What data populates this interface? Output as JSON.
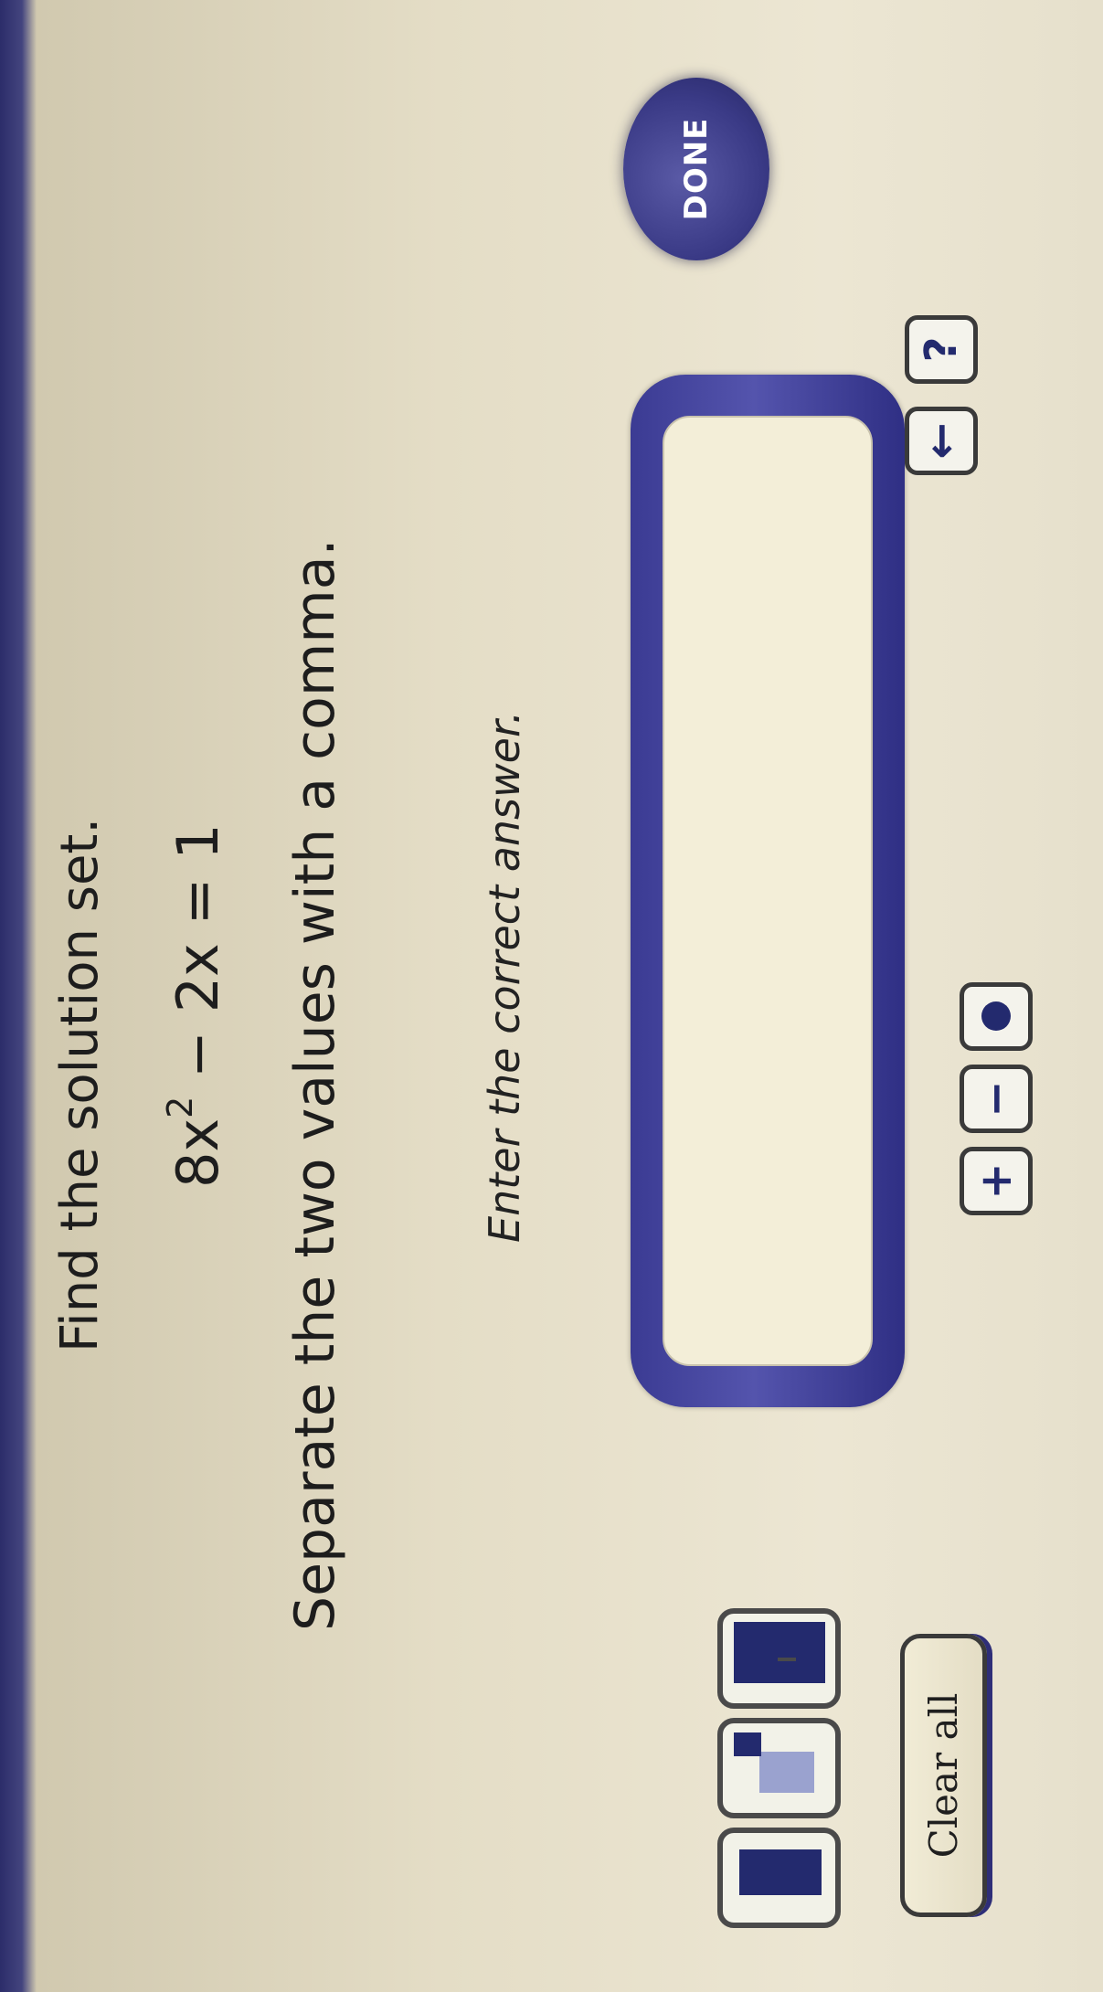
{
  "question": {
    "title": "Find the solution set.",
    "equation": {
      "lhs_coef": "8x",
      "exponent": "2",
      "rest": " − 2x = 1"
    },
    "instruction": "Separate the two values with a comma.",
    "answer_prompt": "Enter the correct answer."
  },
  "answer_field": {
    "value": ""
  },
  "toolbar": {
    "clear_all_label": "Clear all",
    "plus_label": "+",
    "minus_label": "−",
    "back_label": "←",
    "help_label": "?"
  },
  "done_button": {
    "label": "DONE"
  },
  "colors": {
    "accent": "#3b3b93",
    "button_fill": "#232a6e"
  }
}
